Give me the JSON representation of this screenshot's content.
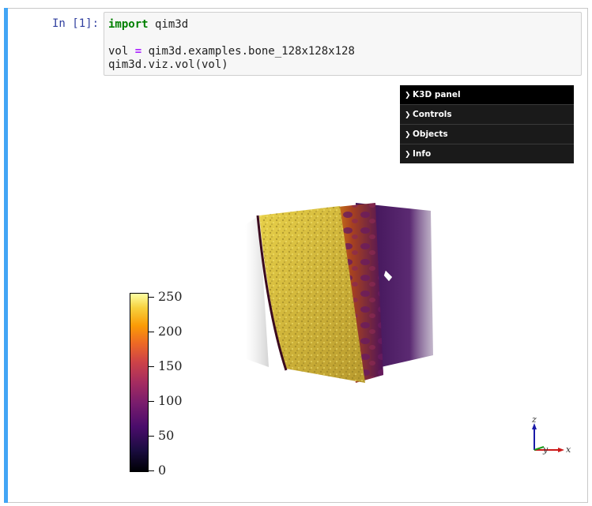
{
  "cell": {
    "prompt": "In [1]:",
    "code": {
      "line1_kw": "import",
      "line1_rest": " qim3d",
      "line3_a": "vol ",
      "line3_op": "=",
      "line3_b": " qim3d.examples.bone_128x128x128",
      "line4": "qim3d.viz.vol(vol)"
    }
  },
  "k3d_panel": {
    "title": "K3D panel",
    "items": [
      {
        "label": "Controls"
      },
      {
        "label": "Objects"
      },
      {
        "label": "Info"
      }
    ]
  },
  "colorbar": {
    "colormap": "inferno",
    "ticks": [
      "250",
      "200",
      "150",
      "100",
      "50",
      "0"
    ],
    "min": 0,
    "max": 255
  },
  "axes": {
    "x": "x",
    "y": "y",
    "z": "z"
  },
  "colors": {
    "cell_accent": "#42a5f5",
    "panel_bg": "#1a1a1a",
    "keyword": "#008000",
    "operator": "#aa22ff"
  }
}
